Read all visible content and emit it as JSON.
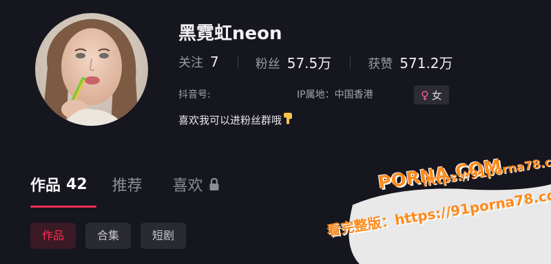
{
  "profile": {
    "nickname": "黑霓虹neon",
    "stats": [
      {
        "label": "关注",
        "value": "7"
      },
      {
        "label": "粉丝",
        "value": "57.5万"
      },
      {
        "label": "获赞",
        "value": "571.2万"
      }
    ],
    "douyin_id_label": "抖音号:",
    "ip_location": "IP属地：中国香港",
    "gender": {
      "icon": "female-icon",
      "label": "女"
    },
    "bio": "喜欢我可以进粉丝群哦",
    "bio_icon": "pointing-down-icon"
  },
  "tabs": [
    {
      "label": "作品",
      "count": "42",
      "active": true
    },
    {
      "label": "推荐",
      "active": false
    },
    {
      "label": "喜欢",
      "icon": "lock-icon",
      "active": false
    }
  ],
  "chips": [
    {
      "label": "作品",
      "active": true
    },
    {
      "label": "合集",
      "active": false
    },
    {
      "label": "短剧",
      "active": false
    }
  ],
  "watermark": {
    "logo": "PORNA.COM",
    "url": "https://91porna78.com",
    "bottom": "看完整版：https://91porna78.com"
  },
  "colors": {
    "background": "#16161f",
    "accent": "#fe2c55",
    "chip_bg": "#2a2a33",
    "watermark": "#ff8a1a"
  }
}
